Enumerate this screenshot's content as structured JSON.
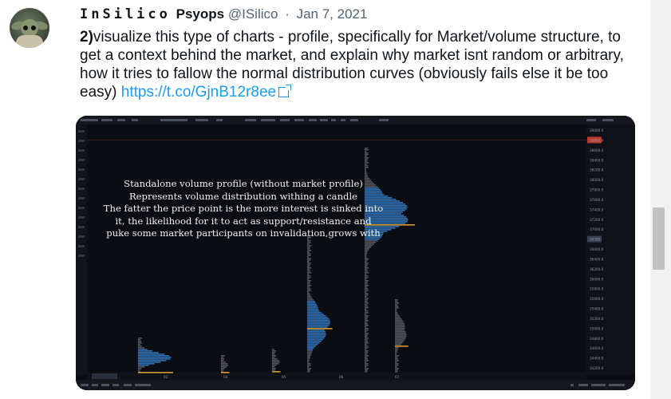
{
  "tweet": {
    "display_name_styled": "InSilico",
    "display_name_rest": "Psyops",
    "handle": "@ISilico",
    "separator": "·",
    "date": "Jan 7, 2021",
    "text_number": "2)",
    "text_body": "visualize this type of charts - profile, specifically for Market/volume structure, to get a context behind the market, and explain why market isnt random or arbitrary, how it tries to fallow the normal distribution curves (obviously fails else it be too easy) ",
    "link": "https://t.co/GjnB12r8ee"
  },
  "media": {
    "caption_lines": [
      "Standalone volume profile (without market profile)",
      "Represents volume distribution withing a candle",
      "The fatter the price point is the more interest is sinked into",
      "it, the likelihood for it to act as support/resistance and",
      "puke some market participants on invalidation,grows with"
    ],
    "chart_data": {
      "type": "bar",
      "ylim": [
        24500,
        39000
      ],
      "price_ticks": [
        "39000.0",
        "38800.0",
        "38600.0",
        "38400.0",
        "38200.0",
        "38000.0",
        "37800.0",
        "37600.0",
        "37400.0",
        "37200.0",
        "37000.0",
        "36780",
        "36600.0",
        "36400.0",
        "36200.0",
        "36000.0",
        "35800.0",
        "35600.0",
        "35400.0",
        "35200.0",
        "35000.0",
        "34800.0",
        "34600.0",
        "34400.0",
        "34200.0"
      ],
      "date_labels": [
        "02",
        "04",
        "05",
        "06",
        "07"
      ],
      "colors": {
        "bar": "#2f6fb0",
        "bar_dim": "#8a8f99",
        "poc": "#d49a2a",
        "highlight_tick": "#c0392b",
        "background": "#0b0d12"
      }
    }
  }
}
